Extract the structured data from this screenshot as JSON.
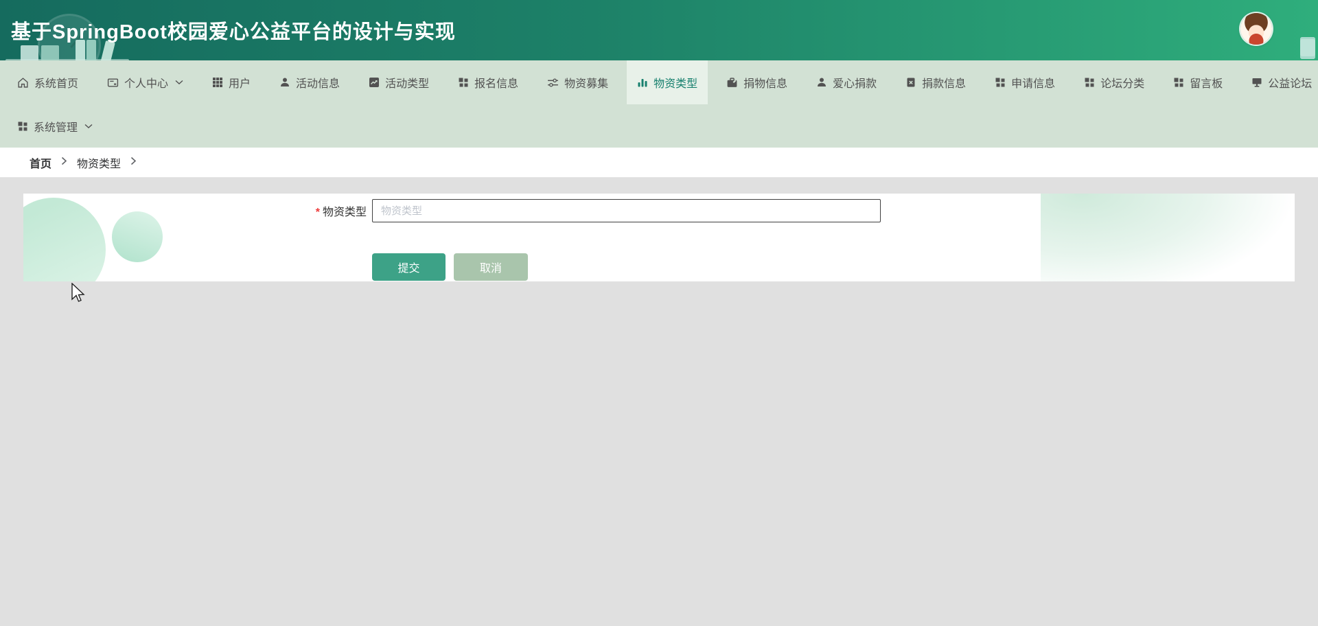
{
  "header": {
    "title": "基于SpringBoot校园爱心公益平台的设计与实现",
    "decorations": [
      "clock-icon",
      "books-icon",
      "monitor-icon",
      "phone-icon",
      "avatar"
    ]
  },
  "nav": {
    "items": [
      {
        "label": "系统首页",
        "icon": "home-icon",
        "active": false
      },
      {
        "label": "个人中心",
        "icon": "card-icon",
        "has_dropdown": true,
        "active": false
      },
      {
        "label": "用户",
        "icon": "grid9-icon",
        "active": false
      },
      {
        "label": "活动信息",
        "icon": "user-icon",
        "active": false
      },
      {
        "label": "活动类型",
        "icon": "chart-line-icon",
        "active": false
      },
      {
        "label": "报名信息",
        "icon": "grid4-icon",
        "active": false
      },
      {
        "label": "物资募集",
        "icon": "sliders-icon",
        "active": false
      },
      {
        "label": "物资类型",
        "icon": "bar-chart-icon",
        "active": true
      },
      {
        "label": "捐物信息",
        "icon": "briefcase-icon",
        "active": false
      },
      {
        "label": "爱心捐款",
        "icon": "user-icon",
        "active": false
      },
      {
        "label": "捐款信息",
        "icon": "doc-x-icon",
        "active": false
      },
      {
        "label": "申请信息",
        "icon": "grid4-icon",
        "active": false
      },
      {
        "label": "论坛分类",
        "icon": "grid4-icon",
        "active": false
      },
      {
        "label": "留言板",
        "icon": "grid4-icon",
        "active": false
      },
      {
        "label": "公益论坛",
        "icon": "monitor-small-icon",
        "active": false
      }
    ],
    "secondary": [
      {
        "label": "系统管理",
        "icon": "grid4-icon",
        "has_dropdown": true
      }
    ]
  },
  "breadcrumb": {
    "items": [
      "首页",
      "物资类型"
    ]
  },
  "form": {
    "required_mark": "*",
    "field_label": "物资类型",
    "input_value": "",
    "input_placeholder": "物资类型",
    "submit_label": "提交",
    "cancel_label": "取消"
  },
  "colors": {
    "header_gradient_start": "#156b5e",
    "header_gradient_end": "#2fae7c",
    "nav_bg": "#d2e1d4",
    "nav_active_bg": "#e8f1e9",
    "nav_text": "#525252",
    "accent_teal": "#17806e",
    "submit_bg": "#3da287",
    "cancel_bg": "#a9c5ac",
    "page_bg": "#e0e0e0",
    "required_red": "#ee3b3b",
    "input_border": "#3f3f3f",
    "placeholder": "#bfc4cc",
    "deco_mint": "#c3e9d6"
  }
}
